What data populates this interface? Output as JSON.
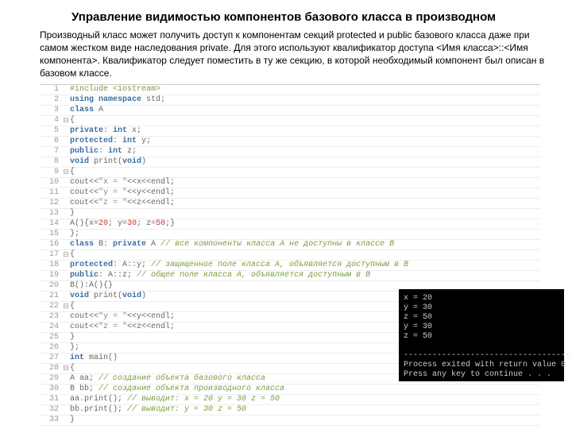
{
  "title": "Управление видимостью компонентов базового класса в производном",
  "paragraph": "Производный класс может получить доступ к компонентам секций protected и public базового класса даже при самом жестком виде наследования private. Для этого используют квалификатор доступа <Имя класса>::<Имя компонента>. Квалификатор следует поместить в ту же секцию, в которой необходимый компонент был описан в базовом классе.",
  "code_lines": [
    {
      "n": 1,
      "fold": "",
      "segs": [
        {
          "c": "directive",
          "t": "#include "
        },
        {
          "c": "directive",
          "t": "<iostream>"
        }
      ]
    },
    {
      "n": 2,
      "fold": "",
      "segs": [
        {
          "c": "keyword",
          "t": "using namespace"
        },
        {
          "c": "op",
          "t": " std;"
        }
      ]
    },
    {
      "n": 3,
      "fold": "",
      "segs": [
        {
          "c": "keyword",
          "t": "class"
        },
        {
          "c": "op",
          "t": " A"
        }
      ]
    },
    {
      "n": 4,
      "fold": "⊟",
      "segs": [
        {
          "c": "op",
          "t": "{"
        }
      ]
    },
    {
      "n": 5,
      "fold": "",
      "segs": [
        {
          "c": "keyword",
          "t": "private"
        },
        {
          "c": "op",
          "t": ": "
        },
        {
          "c": "keyword",
          "t": "int"
        },
        {
          "c": "op",
          "t": " x;"
        }
      ]
    },
    {
      "n": 6,
      "fold": "",
      "segs": [
        {
          "c": "keyword",
          "t": "protected"
        },
        {
          "c": "op",
          "t": ": "
        },
        {
          "c": "keyword",
          "t": "int"
        },
        {
          "c": "op",
          "t": " y;"
        }
      ]
    },
    {
      "n": 7,
      "fold": "",
      "segs": [
        {
          "c": "keyword",
          "t": "public"
        },
        {
          "c": "op",
          "t": ": "
        },
        {
          "c": "keyword",
          "t": "int"
        },
        {
          "c": "op",
          "t": " z;"
        }
      ]
    },
    {
      "n": 8,
      "fold": "",
      "segs": [
        {
          "c": "keyword",
          "t": "void"
        },
        {
          "c": "op",
          "t": " print("
        },
        {
          "c": "keyword",
          "t": "void"
        },
        {
          "c": "op",
          "t": ")"
        }
      ]
    },
    {
      "n": 9,
      "fold": "⊟",
      "segs": [
        {
          "c": "op",
          "t": "{"
        }
      ]
    },
    {
      "n": 10,
      "fold": "",
      "segs": [
        {
          "c": "op",
          "t": "cout<<"
        },
        {
          "c": "string",
          "t": "\"x = \""
        },
        {
          "c": "op",
          "t": "<<x<<endl;"
        }
      ]
    },
    {
      "n": 11,
      "fold": "",
      "segs": [
        {
          "c": "op",
          "t": "cout<<"
        },
        {
          "c": "string",
          "t": "\"y = \""
        },
        {
          "c": "op",
          "t": "<<y<<endl;"
        }
      ]
    },
    {
      "n": 12,
      "fold": "",
      "segs": [
        {
          "c": "op",
          "t": "cout<<"
        },
        {
          "c": "string",
          "t": "\"z = \""
        },
        {
          "c": "op",
          "t": "<<z<<endl;"
        }
      ]
    },
    {
      "n": 13,
      "fold": "",
      "segs": [
        {
          "c": "op",
          "t": "}"
        }
      ]
    },
    {
      "n": 14,
      "fold": "",
      "segs": [
        {
          "c": "op",
          "t": "A(){x="
        },
        {
          "c": "literal",
          "t": "20"
        },
        {
          "c": "op",
          "t": "; y="
        },
        {
          "c": "literal",
          "t": "30"
        },
        {
          "c": "op",
          "t": "; z="
        },
        {
          "c": "literal",
          "t": "50"
        },
        {
          "c": "op",
          "t": ";}"
        }
      ]
    },
    {
      "n": 15,
      "fold": "",
      "segs": [
        {
          "c": "op",
          "t": "};"
        }
      ]
    },
    {
      "n": 16,
      "fold": "",
      "segs": [
        {
          "c": "keyword",
          "t": "class"
        },
        {
          "c": "op",
          "t": " B: "
        },
        {
          "c": "keyword",
          "t": "private"
        },
        {
          "c": "op",
          "t": " A "
        },
        {
          "c": "comment",
          "t": "// все компоненты класса А не доступны в классе B"
        }
      ]
    },
    {
      "n": 17,
      "fold": "⊟",
      "segs": [
        {
          "c": "op",
          "t": "{"
        }
      ]
    },
    {
      "n": 18,
      "fold": "",
      "segs": [
        {
          "c": "keyword",
          "t": "protected"
        },
        {
          "c": "op",
          "t": ": A::y; "
        },
        {
          "c": "comment",
          "t": "// защищенное поле класса А, объявляется доступным в В"
        }
      ]
    },
    {
      "n": 19,
      "fold": "",
      "segs": [
        {
          "c": "keyword",
          "t": "public"
        },
        {
          "c": "op",
          "t": ": A::z; "
        },
        {
          "c": "comment",
          "t": "// общее поле класса А, объявляется доступным в В"
        }
      ]
    },
    {
      "n": 20,
      "fold": "",
      "segs": [
        {
          "c": "op",
          "t": "B():A(){}"
        }
      ]
    },
    {
      "n": 21,
      "fold": "",
      "segs": [
        {
          "c": "keyword",
          "t": "void"
        },
        {
          "c": "op",
          "t": " print("
        },
        {
          "c": "keyword",
          "t": "void"
        },
        {
          "c": "op",
          "t": ")"
        }
      ]
    },
    {
      "n": 22,
      "fold": "⊟",
      "segs": [
        {
          "c": "op",
          "t": "{"
        }
      ]
    },
    {
      "n": 23,
      "fold": "",
      "segs": [
        {
          "c": "op",
          "t": "cout<<"
        },
        {
          "c": "string",
          "t": "\"y = \""
        },
        {
          "c": "op",
          "t": "<<y<<endl;"
        }
      ]
    },
    {
      "n": 24,
      "fold": "",
      "segs": [
        {
          "c": "op",
          "t": "cout<<"
        },
        {
          "c": "string",
          "t": "\"z = \""
        },
        {
          "c": "op",
          "t": "<<z<<endl;"
        }
      ]
    },
    {
      "n": 25,
      "fold": "",
      "segs": [
        {
          "c": "op",
          "t": "}"
        }
      ]
    },
    {
      "n": 26,
      "fold": "",
      "segs": [
        {
          "c": "op",
          "t": "};"
        }
      ]
    },
    {
      "n": 27,
      "fold": "",
      "segs": [
        {
          "c": "keyword",
          "t": "int"
        },
        {
          "c": "op",
          "t": " main()"
        }
      ]
    },
    {
      "n": 28,
      "fold": "⊟",
      "segs": [
        {
          "c": "op",
          "t": "{"
        }
      ]
    },
    {
      "n": 29,
      "fold": "",
      "segs": [
        {
          "c": "op",
          "t": "A aa; "
        },
        {
          "c": "comment",
          "t": "// создание объекта базового класса"
        }
      ]
    },
    {
      "n": 30,
      "fold": "",
      "segs": [
        {
          "c": "op",
          "t": "B bb; "
        },
        {
          "c": "comment",
          "t": "// создание объекта производного класса"
        }
      ]
    },
    {
      "n": 31,
      "fold": "",
      "segs": [
        {
          "c": "op",
          "t": "aa.print(); "
        },
        {
          "c": "comment",
          "t": "// выводит: x = 20 y = 30 z = 50"
        }
      ]
    },
    {
      "n": 32,
      "fold": "",
      "segs": [
        {
          "c": "op",
          "t": "bb.print(); "
        },
        {
          "c": "comment",
          "t": "// выводит: y = 30 z = 50"
        }
      ]
    },
    {
      "n": 33,
      "fold": "",
      "segs": [
        {
          "c": "op",
          "t": "}"
        }
      ]
    }
  ],
  "console_output": "x = 20\ny = 30\nz = 50\ny = 30\nz = 50\n\n------------------------------------\nProcess exited with return value 0\nPress any key to continue . . ."
}
